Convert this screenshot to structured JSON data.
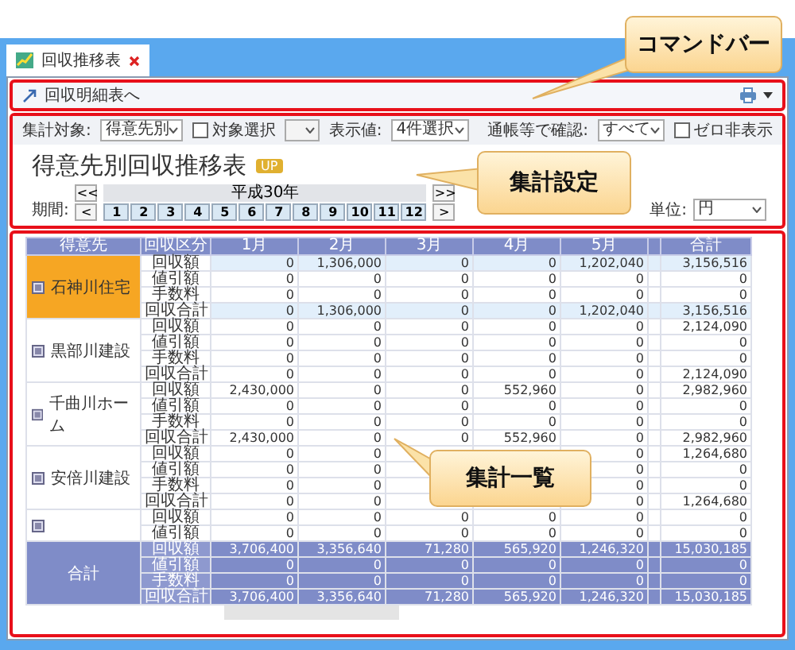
{
  "tab": {
    "title": "回収推移表"
  },
  "command_bar": {
    "link": "回収明細表へ"
  },
  "settings": {
    "target_label": "集計対象:",
    "target_value": "得意先別",
    "select_check": {
      "label": "対象選択",
      "checked": false
    },
    "display_label": "表示値:",
    "display_value": "4件選択",
    "confirm_label": "通帳等で確認:",
    "confirm_value": "すべて",
    "zero_check": {
      "label": "ゼロ非表示",
      "checked": false
    }
  },
  "report": {
    "title": "得意先別回収推移表",
    "badge": "UP",
    "period_label": "期間:",
    "year": "平成30年",
    "months": [
      "1",
      "2",
      "3",
      "4",
      "5",
      "6",
      "7",
      "8",
      "9",
      "10",
      "11",
      "12"
    ],
    "first": "<<",
    "prev": "<",
    "next": ">",
    "last": ">>",
    "unit_label": "単位:",
    "unit": "円"
  },
  "table": {
    "columns": [
      "得意先",
      "回収区分",
      "1月",
      "2月",
      "3月",
      "4月",
      "5月",
      "合計"
    ],
    "groups": [
      {
        "name": "石神川住宅",
        "selected": true,
        "kind": "full",
        "rows": [
          {
            "label": "回収額",
            "values": [
              "0",
              "1,306,000",
              "0",
              "0",
              "1,202,040",
              "3,156,516"
            ]
          },
          {
            "label": "値引額",
            "values": [
              "0",
              "0",
              "0",
              "0",
              "0",
              "0"
            ]
          },
          {
            "label": "手数料",
            "values": [
              "0",
              "0",
              "0",
              "0",
              "0",
              "0"
            ]
          },
          {
            "label": "回収合計",
            "values": [
              "0",
              "1,306,000",
              "0",
              "0",
              "1,202,040",
              "3,156,516"
            ]
          }
        ]
      },
      {
        "name": "黒部川建設",
        "selected": false,
        "kind": "full",
        "rows": [
          {
            "label": "回収額",
            "values": [
              "0",
              "0",
              "0",
              "0",
              "0",
              "2,124,090"
            ]
          },
          {
            "label": "値引額",
            "values": [
              "0",
              "0",
              "0",
              "0",
              "0",
              "0"
            ]
          },
          {
            "label": "手数料",
            "values": [
              "0",
              "0",
              "0",
              "0",
              "0",
              "0"
            ]
          },
          {
            "label": "回収合計",
            "values": [
              "0",
              "0",
              "0",
              "0",
              "0",
              "2,124,090"
            ]
          }
        ]
      },
      {
        "name": "千曲川ホーム",
        "selected": false,
        "kind": "full",
        "rows": [
          {
            "label": "回収額",
            "values": [
              "2,430,000",
              "0",
              "0",
              "552,960",
              "0",
              "2,982,960"
            ]
          },
          {
            "label": "値引額",
            "values": [
              "0",
              "0",
              "0",
              "0",
              "0",
              "0"
            ]
          },
          {
            "label": "手数料",
            "values": [
              "0",
              "0",
              "0",
              "0",
              "0",
              "0"
            ]
          },
          {
            "label": "回収合計",
            "values": [
              "2,430,000",
              "0",
              "0",
              "552,960",
              "0",
              "2,982,960"
            ]
          }
        ]
      },
      {
        "name": "安倍川建設",
        "selected": false,
        "kind": "covered",
        "rows": [
          {
            "label": "回収額",
            "values": [
              "0",
              "0",
              "0",
              "1,264,680"
            ]
          },
          {
            "label": "値引額",
            "values": [
              "0",
              "0",
              "0",
              "0"
            ]
          },
          {
            "label": "手数料",
            "values": [
              "0",
              "0",
              "0",
              "0"
            ]
          },
          {
            "label": "回収合計",
            "values": [
              "0",
              "0",
              "0",
              "1,264,680"
            ]
          }
        ]
      },
      {
        "selected": false,
        "kind": "full",
        "rows": [
          {
            "label": "回収額",
            "values": [
              "0",
              "0",
              "0",
              "0",
              "0",
              "0"
            ]
          },
          {
            "label": "値引額",
            "values": [
              "0",
              "0",
              "0",
              "0",
              "0",
              "0"
            ]
          }
        ]
      }
    ],
    "total": {
      "name": "合計",
      "kind": "full",
      "rows": [
        {
          "label": "回収額",
          "values": [
            "3,706,400",
            "3,356,640",
            "71,280",
            "565,920",
            "1,246,320",
            "15,030,185"
          ]
        },
        {
          "label": "値引額",
          "values": [
            "0",
            "0",
            "0",
            "0",
            "0",
            "0"
          ]
        },
        {
          "label": "手数料",
          "values": [
            "0",
            "0",
            "0",
            "0",
            "0",
            "0"
          ]
        },
        {
          "label": "回収合計",
          "values": [
            "3,706,400",
            "3,356,640",
            "71,280",
            "565,920",
            "1,246,320",
            "15,030,185"
          ]
        }
      ]
    }
  },
  "callouts": [
    {
      "text": "コマンドバー"
    },
    {
      "text": "集計設定"
    },
    {
      "text": "集計一覧"
    }
  ]
}
